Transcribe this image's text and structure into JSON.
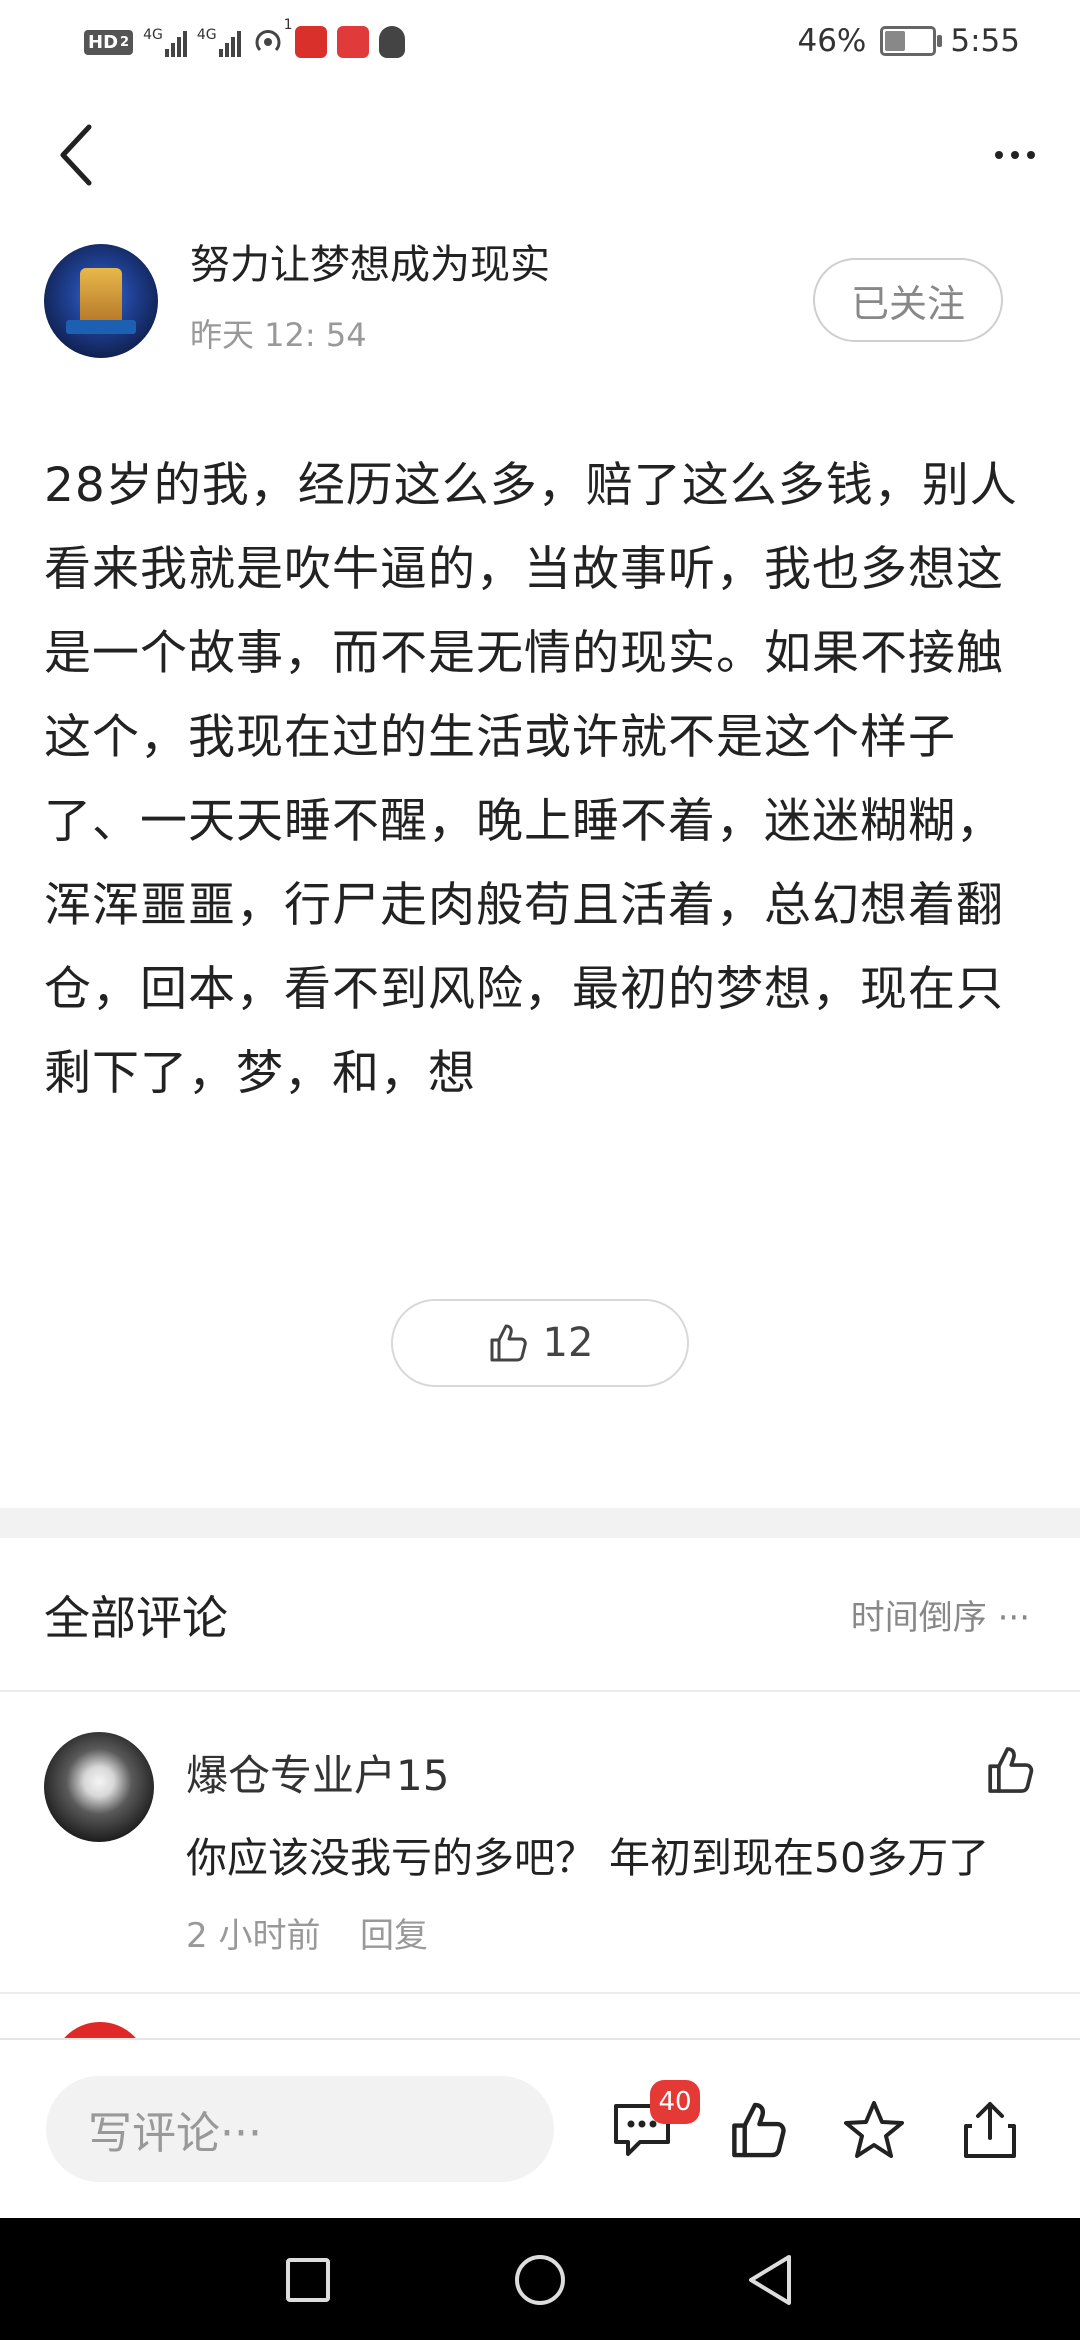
{
  "status_bar": {
    "left_indicators": [
      "HD",
      "2",
      "4G",
      "4G",
      "1"
    ],
    "battery": "46%",
    "battery_level": 0.46,
    "time": "5:55"
  },
  "nav": {
    "back_icon": "chevron-left-icon",
    "more_icon": "more-dots-icon"
  },
  "author": {
    "name": "努力让梦想成为现实",
    "time": "昨天 12: 54",
    "follow_label": "已关注"
  },
  "post": {
    "content": "28岁的我，经历这么多，赔了这么多钱，别人看来我就是吹牛逼的，当故事听，我也多想这是一个故事，而不是无情的现实。如果不接触这个，我现在过的生活或许就不是这个样子了、一天天睡不醒，晚上睡不着，迷迷糊糊，浑浑噩噩，行尸走肉般苟且活着，总幻想着翻仓，回本，看不到风险，最初的梦想，现在只剩下了，梦，和，想",
    "like_count": "12"
  },
  "comments": {
    "title": "全部评论",
    "sort_label": "时间倒序 ···",
    "items": [
      {
        "user": "爆仓专业户15",
        "text": "你应该没我亏的多吧？ 年初到现在50多万了",
        "time": "2 小时前",
        "reply_label": "回复"
      }
    ]
  },
  "bottom_bar": {
    "input_placeholder": "写评论···",
    "comment_count": "40",
    "icons": [
      "comment-icon",
      "thumbs-up-icon",
      "star-icon",
      "share-icon"
    ]
  },
  "colors": {
    "badge": "#e53935",
    "muted_text": "#999999",
    "divider": "#f2f2f2"
  }
}
